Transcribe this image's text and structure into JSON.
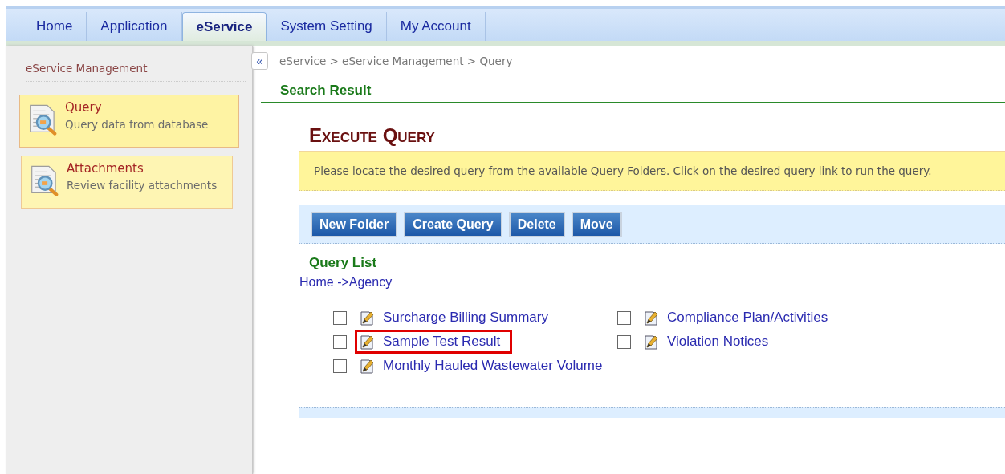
{
  "tabs": [
    {
      "label": "Home",
      "selected": false
    },
    {
      "label": "Application",
      "selected": false
    },
    {
      "label": "eService",
      "selected": true
    },
    {
      "label": "System Setting",
      "selected": false
    },
    {
      "label": "My Account",
      "selected": false
    }
  ],
  "sidebar": {
    "title": "eService Management",
    "items": [
      {
        "title": "Query",
        "description": "Query data from database",
        "selected": true
      },
      {
        "title": "Attachments",
        "description": "Review facility attachments",
        "selected": false
      }
    ]
  },
  "collapse_button": "«",
  "breadcrumb": "eService > eService Management > Query",
  "section_title": "Search Result",
  "page_title": "Execute Query",
  "notice": "Please locate the desired query from the available Query Folders. Click on the desired query link to run the query.",
  "buttons": [
    "New Folder",
    "Create Query",
    "Delete",
    "Move"
  ],
  "query_list": {
    "title": "Query List",
    "path": "Home ->Agency",
    "items": [
      {
        "label": "Surcharge Billing Summary",
        "checked": false,
        "highlighted": false
      },
      {
        "label": "Compliance Plan/Activities",
        "checked": false,
        "highlighted": false
      },
      {
        "label": "Sample Test Result",
        "checked": false,
        "highlighted": true
      },
      {
        "label": "Violation Notices",
        "checked": false,
        "highlighted": false
      },
      {
        "label": "Monthly Hauled Wastewater Volume",
        "checked": false,
        "highlighted": false
      }
    ]
  }
}
